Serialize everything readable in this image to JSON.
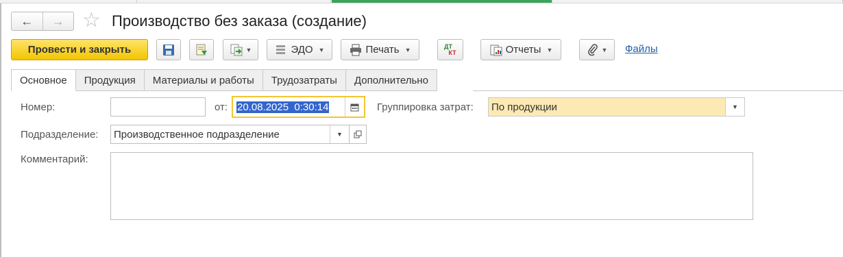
{
  "window": {
    "title": "Производство без заказа (создание)"
  },
  "nav": {
    "back_icon": "←",
    "forward_icon": "→",
    "favorite_icon": "☆"
  },
  "toolbar": {
    "post_close_label": "Провести и закрыть",
    "edo_label": "ЭДО",
    "print_label": "Печать",
    "dtkt_top": "ДТ",
    "dtkt_bottom": "КТ",
    "reports_label": "Отчеты",
    "files_label": "Файлы",
    "dropdown_glyph": "▼"
  },
  "tabs": [
    {
      "label": "Основное",
      "active": true
    },
    {
      "label": "Продукция",
      "active": false
    },
    {
      "label": "Материалы и работы",
      "active": false
    },
    {
      "label": "Трудозатраты",
      "active": false
    },
    {
      "label": "Дополнительно",
      "active": false
    }
  ],
  "form": {
    "number_label": "Номер:",
    "number_value": "",
    "date_label": "от:",
    "date_value": "20.08.2025  0:30:14",
    "grouping_label": "Группировка затрат:",
    "grouping_value": "По продукции",
    "division_label": "Подразделение:",
    "division_value": "Производственное подразделение",
    "comment_label": "Комментарий:",
    "comment_value": ""
  },
  "colors": {
    "primary_button": "#f2c500",
    "focus_border": "#f3c532",
    "selection": "#3366cc",
    "link": "#1f5fa8",
    "grouping_bg": "#fde9b4"
  }
}
